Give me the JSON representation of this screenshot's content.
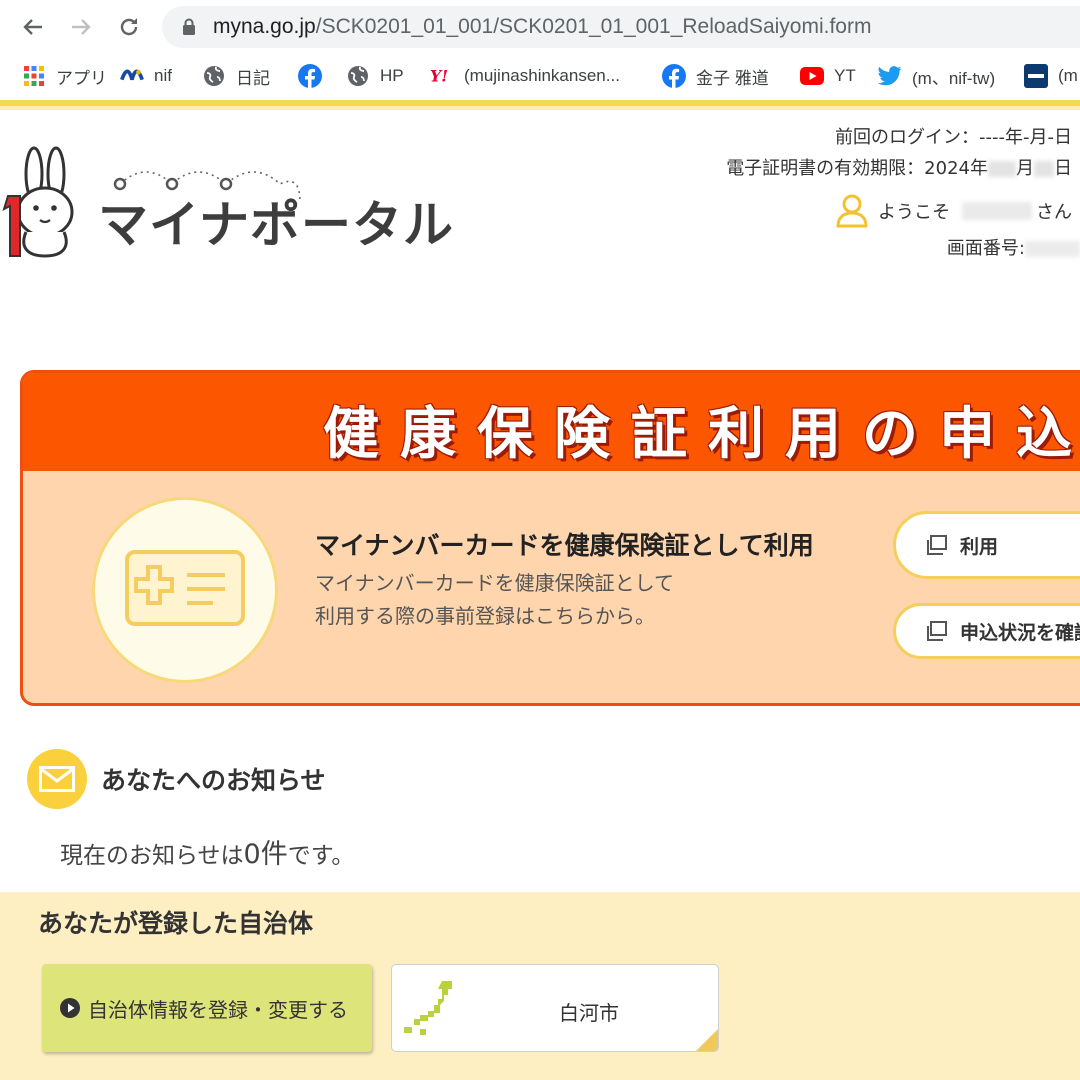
{
  "browser": {
    "url_host": "myna.go.jp",
    "url_path": "/SCK0201_01_001/SCK0201_01_001_ReloadSaiyomi.form",
    "bookmarks": [
      {
        "label": "アプリ",
        "icon": "apps-grid-icon"
      },
      {
        "label": "nif",
        "icon": "nifty-icon"
      },
      {
        "label": "日記",
        "icon": "globe-icon"
      },
      {
        "label": "",
        "icon": "facebook-icon"
      },
      {
        "label": "HP",
        "icon": "globe-icon"
      },
      {
        "label": "(mujinashinkansen...",
        "icon": "yahoo-icon"
      },
      {
        "label": "金子 雅道",
        "icon": "facebook-icon"
      },
      {
        "label": "YT",
        "icon": "youtube-icon"
      },
      {
        "label": "(m、nif-tw)",
        "icon": "twitter-icon"
      },
      {
        "label": "(m",
        "icon": "nikkei-icon"
      }
    ]
  },
  "header": {
    "logo_text": "マイナポータル",
    "last_login": "前回のログイン：----年-月-日",
    "cert_expiry_prefix": "電子証明書の有効期限：2024年",
    "cert_expiry_month_suffix": "月",
    "cert_expiry_day_suffix": "日",
    "welcome_prefix": "ようこそ",
    "welcome_suffix": "さん",
    "screen_no_label": "画面番号:"
  },
  "health_panel": {
    "title": "健康保険証利用の申込",
    "heading": "マイナンバーカードを健康保険証として利用",
    "desc_line1": "マイナンバーカードを健康保険証として",
    "desc_line2": "利用する際の事前登録はこちらから。",
    "button1": "利用",
    "button2": "申込状況を確認"
  },
  "notices": {
    "title": "あなたへのお知らせ",
    "text_prefix": "現在のお知らせは",
    "count": "0件",
    "text_suffix": "です。"
  },
  "municipality": {
    "title": "あなたが登録した自治体",
    "register_button": "自治体情報を登録・変更する",
    "city": "白河市"
  },
  "colors": {
    "orange_header": "#fc5600",
    "panel_bg": "#ffd5ae",
    "gold": "#f5d94e",
    "muni_bg": "#fdefc2",
    "register_button": "#dde47a"
  }
}
